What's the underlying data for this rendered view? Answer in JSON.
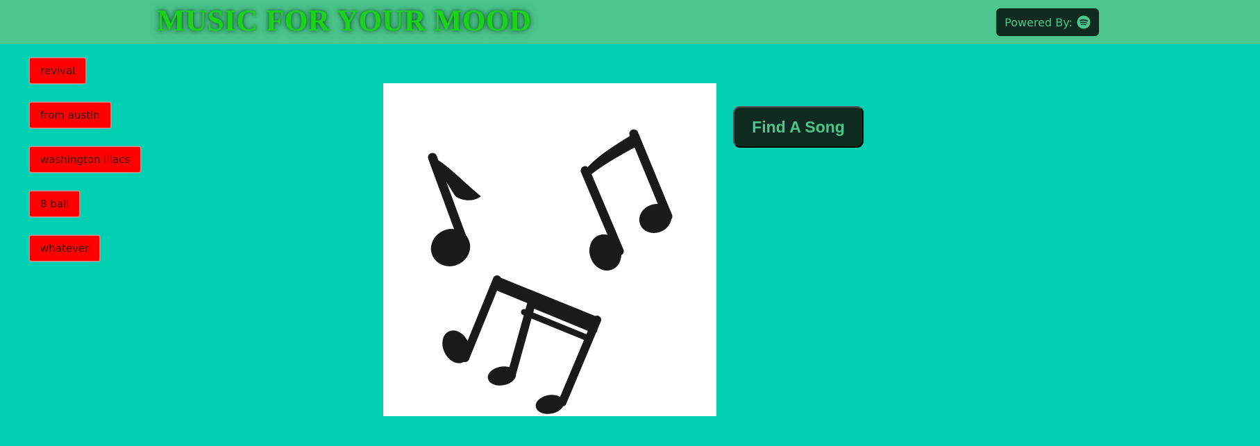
{
  "header": {
    "title": "MUSIC FOR YOUR MOOD",
    "powered_by": {
      "label": "Powered By:",
      "icon": "spotify-icon"
    }
  },
  "songs": [
    {
      "label": "revival"
    },
    {
      "label": "from austin"
    },
    {
      "label": "washington lilacs"
    },
    {
      "label": "8 ball"
    },
    {
      "label": "whatever"
    }
  ],
  "main": {
    "image_icon": "music-notes-icon",
    "find_button_label": "Find A Song"
  },
  "colors": {
    "page_background": "#00d0b2",
    "header_background": "#4cc68d",
    "title_text": "#19d419",
    "dark_button": "#0f2a1f",
    "song_button": "#ff0000"
  }
}
